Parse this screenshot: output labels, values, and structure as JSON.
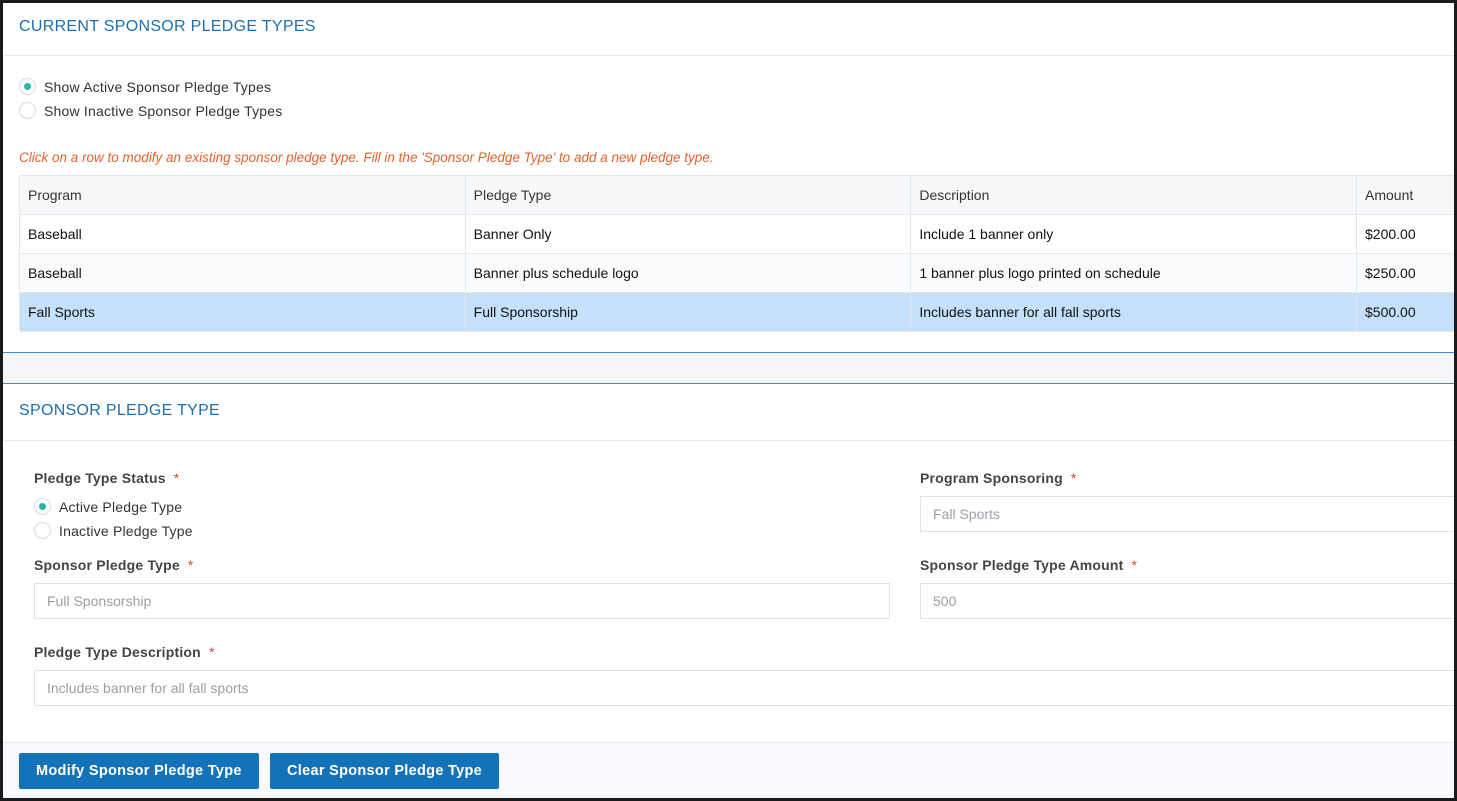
{
  "list_section": {
    "title": "CURRENT SPONSOR PLEDGE TYPES",
    "filters": [
      {
        "label": "Show Active Sponsor Pledge Types",
        "checked": true
      },
      {
        "label": "Show Inactive Sponsor Pledge Types",
        "checked": false
      }
    ],
    "hint": "Click on a row to modify an existing sponsor pledge type. Fill in the 'Sponsor Pledge Type' to add a new pledge type.",
    "table": {
      "columns": [
        "Program",
        "Pledge Type",
        "Description",
        "Amount"
      ],
      "rows": [
        {
          "program": "Baseball",
          "pledge_type": "Banner Only",
          "description": "Include 1 banner only",
          "amount": "$200.00",
          "selected": false
        },
        {
          "program": "Baseball",
          "pledge_type": "Banner plus schedule logo",
          "description": "1 banner plus logo printed on schedule",
          "amount": "$250.00",
          "selected": false
        },
        {
          "program": "Fall Sports",
          "pledge_type": "Full Sponsorship",
          "description": "Includes banner for all fall sports",
          "amount": "$500.00",
          "selected": true
        }
      ]
    }
  },
  "form_section": {
    "title": "SPONSOR PLEDGE TYPE",
    "status": {
      "label": "Pledge Type Status",
      "required_mark": "*",
      "options": [
        {
          "label": "Active Pledge Type",
          "checked": true
        },
        {
          "label": "Inactive Pledge Type",
          "checked": false
        }
      ]
    },
    "program": {
      "label": "Program Sponsoring",
      "required_mark": "*",
      "value": "Fall Sports"
    },
    "pledge_type": {
      "label": "Sponsor Pledge Type",
      "required_mark": "*",
      "value": "Full Sponsorship"
    },
    "amount": {
      "label": "Sponsor Pledge Type Amount",
      "required_mark": "*",
      "value": "500"
    },
    "description": {
      "label": "Pledge Type Description",
      "required_mark": "*",
      "value": "Includes banner for all fall sports"
    }
  },
  "actions": {
    "modify_label": "Modify Sponsor Pledge Type",
    "clear_label": "Clear Sponsor Pledge Type"
  },
  "colors": {
    "title": "#1d6fae",
    "hint": "#e8602c",
    "selected_row": "#c5e0fa",
    "button": "#1473b8",
    "radio_checked": "#2bb3a6",
    "required": "#e0443a"
  }
}
